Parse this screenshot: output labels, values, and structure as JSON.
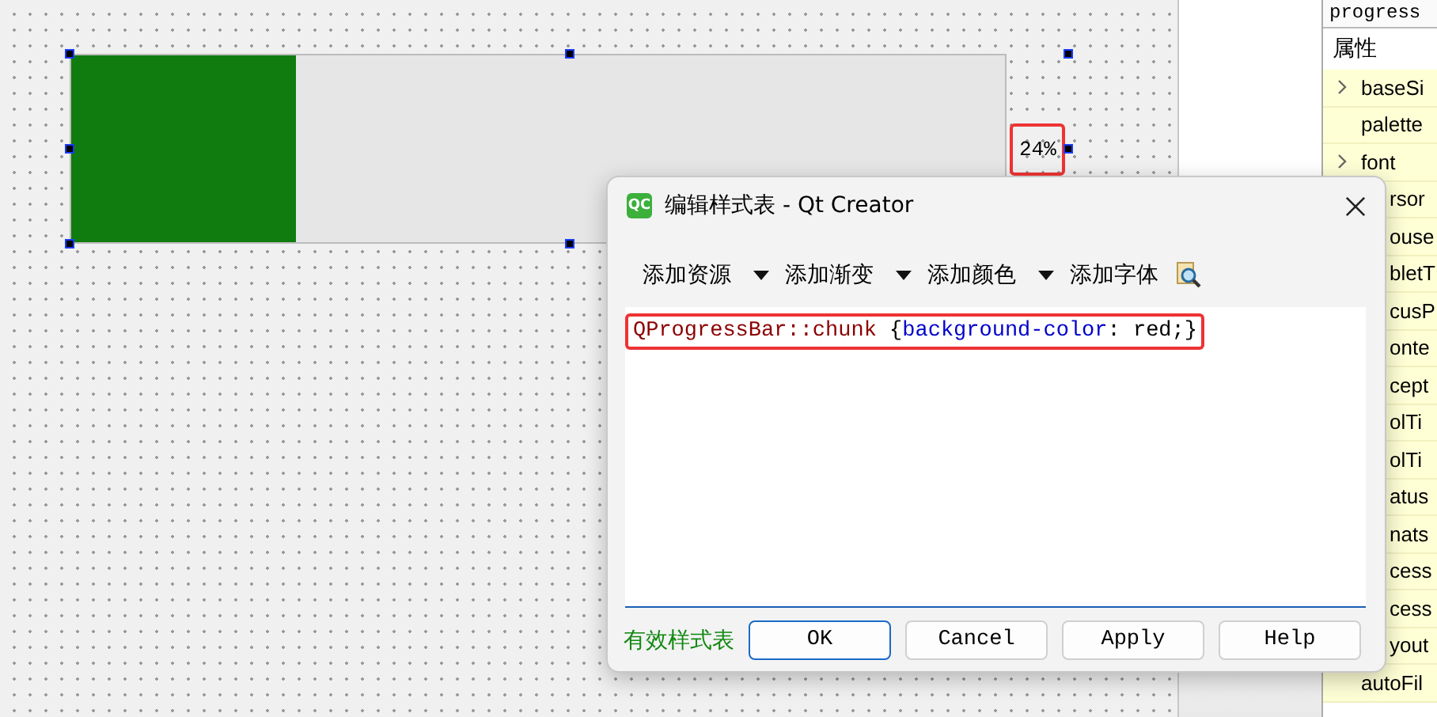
{
  "form": {
    "progress_bar": {
      "level": 0.24,
      "label": "24%",
      "label_marked": true
    }
  },
  "property_editor": {
    "object_name": "progress",
    "header": "属性",
    "rows": [
      {
        "name": "baseSi",
        "expandable": true,
        "covered": false
      },
      {
        "name": "palette",
        "expandable": false,
        "covered": false
      },
      {
        "name": "font",
        "expandable": true,
        "covered": false
      },
      {
        "name": "rsor",
        "expandable": false,
        "covered": true
      },
      {
        "name": "ouse",
        "expandable": false,
        "covered": true
      },
      {
        "name": "bletT",
        "expandable": false,
        "covered": true
      },
      {
        "name": "cusP",
        "expandable": false,
        "covered": true
      },
      {
        "name": "onte",
        "expandable": false,
        "covered": true
      },
      {
        "name": "cept",
        "expandable": false,
        "covered": true
      },
      {
        "name": "olTi",
        "expandable": false,
        "covered": true
      },
      {
        "name": "olTi",
        "expandable": false,
        "covered": true
      },
      {
        "name": "atus",
        "expandable": false,
        "covered": true
      },
      {
        "name": "nats",
        "expandable": false,
        "covered": true
      },
      {
        "name": "cess",
        "expandable": false,
        "covered": true
      },
      {
        "name": "cess",
        "expandable": false,
        "covered": true
      },
      {
        "name": "yout",
        "expandable": false,
        "covered": true
      },
      {
        "name": "autoFil",
        "expandable": false,
        "covered": false
      }
    ]
  },
  "dialog": {
    "title": "编辑样式表 - Qt Creator",
    "app_icon": "QC",
    "toolbar": [
      {
        "label": "添加资源",
        "kind": "dropdown"
      },
      {
        "label": "添加渐变",
        "kind": "dropdown"
      },
      {
        "label": "添加颜色",
        "kind": "dropdown"
      },
      {
        "label": "添加字体",
        "kind": "button"
      },
      {
        "kind": "icon"
      }
    ],
    "code": {
      "marked": true,
      "tokens": [
        {
          "text": "QProgressBar::chunk",
          "kind": "selector"
        },
        {
          "text": " {",
          "kind": "plain"
        },
        {
          "text": "background-color",
          "kind": "property"
        },
        {
          "text": ": red;}",
          "kind": "plain"
        }
      ]
    },
    "status": "有效样式表",
    "buttons": [
      {
        "label": "OK",
        "selected": true
      },
      {
        "label": "Cancel",
        "selected": false
      },
      {
        "label": "Apply",
        "selected": false
      },
      {
        "label": "Help",
        "selected": false
      }
    ]
  }
}
